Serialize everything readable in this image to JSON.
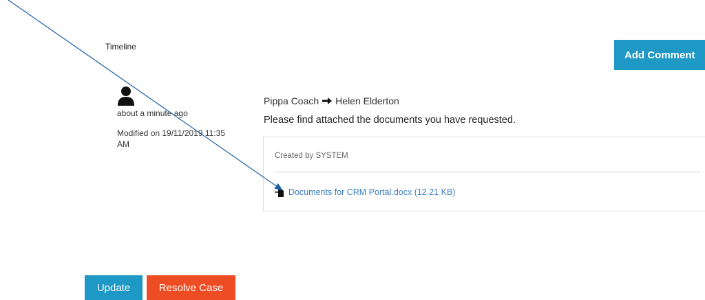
{
  "timeline": {
    "heading": "Timeline",
    "add_comment_label": "Add Comment"
  },
  "entry": {
    "relative_time": "about a minute ago",
    "modified": "Modified on 19/11/2019 11:35 AM",
    "from": "Pippa Coach",
    "to": "Helen Elderton",
    "message": "Please find attached the documents you have requested.",
    "created_by": "Created by SYSTEM",
    "attachment": {
      "label": "Documents for CRM Portal.docx (12.21 KB)",
      "icon": "file-icon"
    }
  },
  "actions": {
    "update_label": "Update",
    "resolve_label": "Resolve Case"
  },
  "colors": {
    "primary": "#1e98c4",
    "danger": "#ee4c23",
    "link": "#3a7fc1",
    "annotation_arrow": "#1a5fa8"
  }
}
